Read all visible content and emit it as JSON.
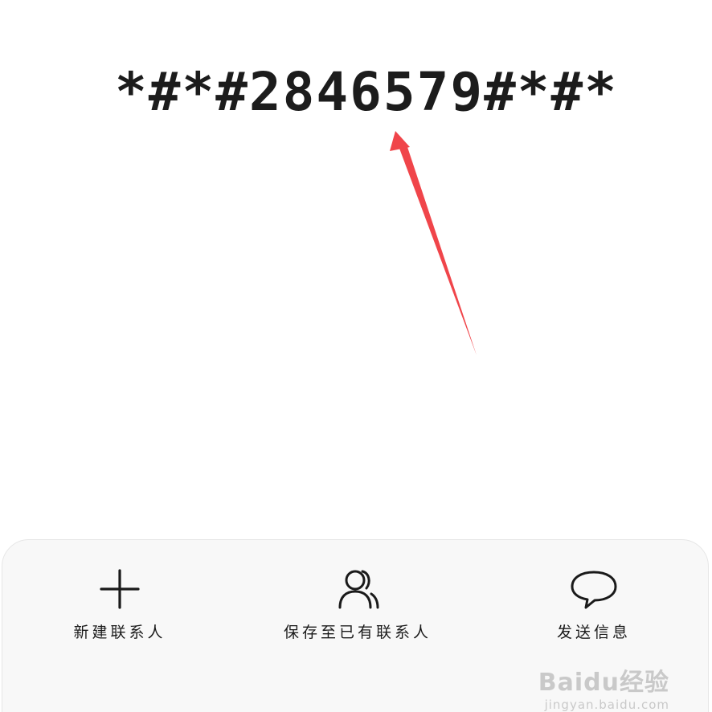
{
  "dialer": {
    "number": "*#*#2846579#*#*"
  },
  "actions": [
    {
      "label": "新建联系人",
      "icon": "plus-icon"
    },
    {
      "label": "保存至已有联系人",
      "icon": "contacts-icon"
    },
    {
      "label": "发送信息",
      "icon": "message-icon"
    }
  ],
  "annotation": {
    "color": "#f0454a"
  },
  "watermark": {
    "logo": "Baidu经验",
    "url": "jingyan.baidu.com"
  }
}
